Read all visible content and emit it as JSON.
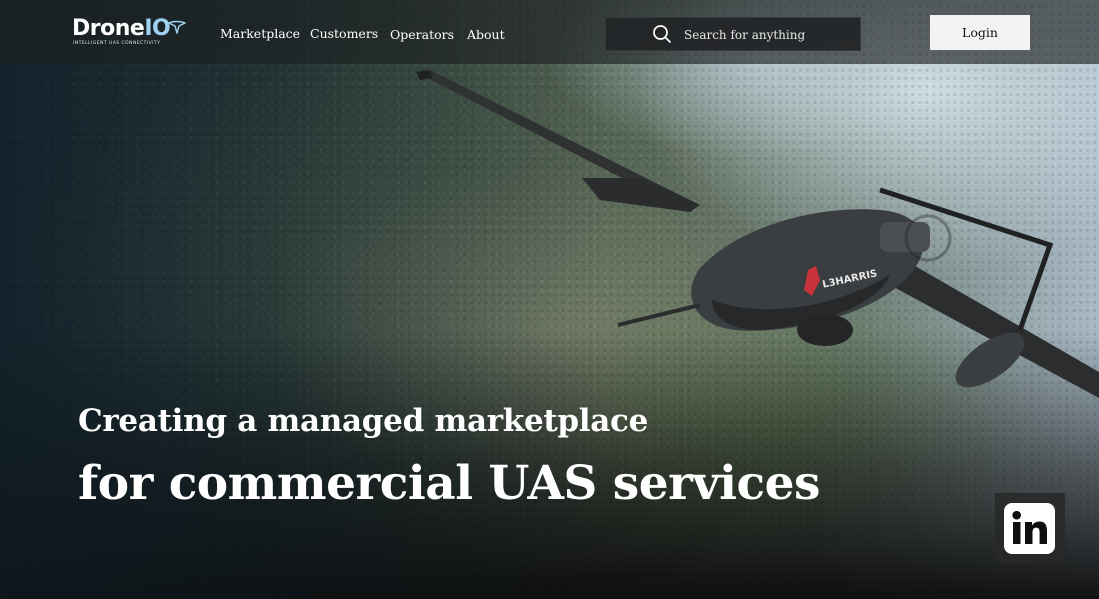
{
  "brand": {
    "name_prefix": "Drone",
    "name_suffix": "IO",
    "tagline": "INTELLIGENT UAS CONNECTIVITY",
    "logo_mark_icon": "drone-arrow-icon",
    "accent_color": "#9fd2f2"
  },
  "nav": {
    "items": [
      {
        "label": "Marketplace"
      },
      {
        "label": "Customers"
      },
      {
        "label": "Operators"
      },
      {
        "label": "About"
      }
    ]
  },
  "search": {
    "placeholder": "Search for anything",
    "value": "",
    "icon": "search-icon"
  },
  "login": {
    "label": "Login"
  },
  "hero": {
    "headline_line1": "Creating a managed marketplace",
    "headline_line2": "for commercial UAS services",
    "drone_livery": "L3HARRIS",
    "livery_color": "#c8333a"
  },
  "social": {
    "icon": "linkedin-icon"
  }
}
